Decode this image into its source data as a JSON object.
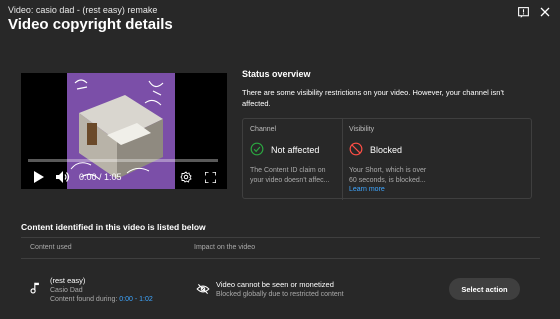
{
  "header": {
    "video_label": "Video: casio dad - (rest easy) remake",
    "title": "Video copyright details",
    "icons": [
      "feedback-icon",
      "close-icon"
    ]
  },
  "player": {
    "time": "0:00 / 1:05",
    "progress": 0,
    "icons": [
      "play-icon",
      "volume-icon",
      "settings-icon",
      "fullscreen-icon"
    ]
  },
  "status": {
    "title": "Status overview",
    "description": "There are some visibility restrictions on your video. However, your channel isn't affected.",
    "channel": {
      "label": "Channel",
      "value": "Not affected",
      "description": "The Content ID claim on your video doesn't affec...",
      "icon": "check-circle-icon",
      "color": "#2ba640"
    },
    "visibility": {
      "label": "Visibility",
      "value": "Blocked",
      "description": "Your Short, which is over 60 seconds, is blocked...",
      "link": "Learn more",
      "icon": "blocked-icon",
      "color": "#ff4e45"
    }
  },
  "content": {
    "title": "Content identified in this video is listed below",
    "columns": [
      "Content used",
      "Impact on the video"
    ],
    "rows": [
      {
        "song": "(rest easy)",
        "artist": "Casio Dad",
        "found_label": "Content found during:",
        "found_range": "0:00 - 1:02",
        "impact": "Video cannot be seen or monetized",
        "impact_detail": "Blocked globally due to restricted content",
        "action": "Select action"
      }
    ]
  },
  "colors": {
    "background": "#282828",
    "link": "#3ea6ff",
    "button": "#3f3f3f"
  }
}
